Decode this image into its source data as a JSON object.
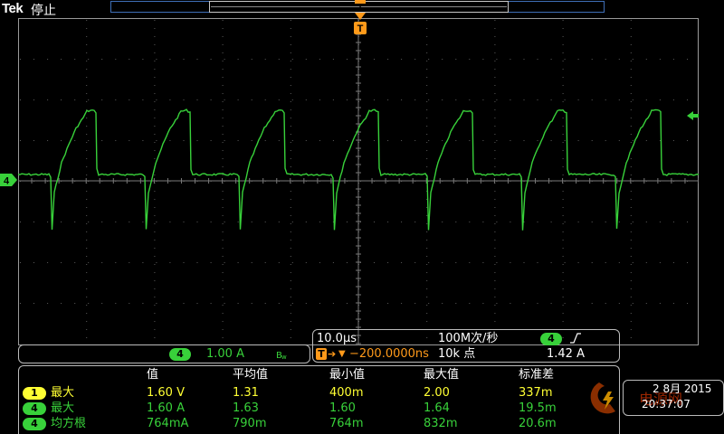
{
  "header": {
    "brand": "Tek",
    "run_state": "停止"
  },
  "markers": {
    "trigger_position_label": "T",
    "channel_ground_label": "4"
  },
  "channel_readout": {
    "channel": "4",
    "scale": "1.00 A",
    "bandwidth_icon": "bandwidth-limit-icon"
  },
  "timebase": {
    "scale": "10.0µs",
    "sample_rate": "100M次/秒",
    "trigger_delay_prefix": "T",
    "trigger_delay": "−200.0000ns",
    "record_length": "10k 点",
    "trigger_channel": "4",
    "trigger_slope_icon": "rising-edge-icon",
    "trigger_level": "1.42 A"
  },
  "measurements": {
    "headers": [
      "值",
      "平均值",
      "最小值",
      "最大值",
      "标准差"
    ],
    "rows": [
      {
        "channel": "1",
        "color": "#ffff33",
        "name": "最大",
        "values": [
          "1.60 V",
          "1.31",
          "400m",
          "2.00",
          "337m"
        ]
      },
      {
        "channel": "4",
        "color": "#38d13a",
        "name": "最大",
        "values": [
          "1.60 A",
          "1.63",
          "1.60",
          "1.64",
          "19.5m"
        ]
      },
      {
        "channel": "4",
        "color": "#38d13a",
        "name": "均方根",
        "values": [
          "764mA",
          "790m",
          "764m",
          "832m",
          "20.6m"
        ]
      }
    ]
  },
  "datetime": {
    "date": "2 8月 2015",
    "time": "20:37:07"
  },
  "watermark": {
    "text": "电源网"
  },
  "colors": {
    "ch1": "#ffff33",
    "ch4": "#38d13a",
    "trigger": "#ff9a1a",
    "record_bar": "#3f6fb6"
  },
  "waveform": {
    "channel": "4",
    "pulses": 7,
    "description_values": {
      "baseline_level_A": 0.0,
      "peak_level_A": 1.6,
      "negative_spike_A": -1.15
    }
  }
}
